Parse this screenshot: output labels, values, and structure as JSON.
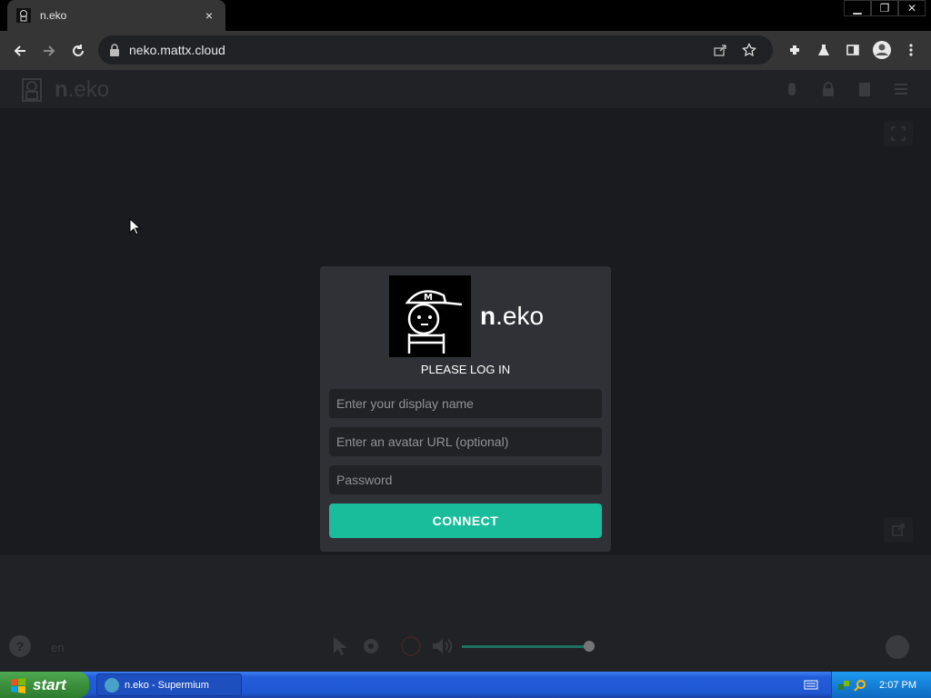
{
  "browser": {
    "tab_title": "n.eko",
    "tab_close": "×",
    "url": "neko.mattx.cloud",
    "window_buttons": {
      "minimize": "▁",
      "restore": "❐",
      "close": "✕"
    }
  },
  "neko": {
    "logo_bold": "n",
    "logo_rest": ".eko",
    "login": {
      "title": "PLEASE LOG IN",
      "name_placeholder": "Enter your display name",
      "avatar_placeholder": "Enter an avatar URL (optional)",
      "password_placeholder": "Password",
      "connect_label": "CONNECT"
    },
    "controls": {
      "help": "?",
      "language": "en"
    },
    "accent": "#19bd9c"
  },
  "taskbar": {
    "start_label": "start",
    "task_item": "n.eko - Supermium",
    "clock": "2:07 PM"
  }
}
